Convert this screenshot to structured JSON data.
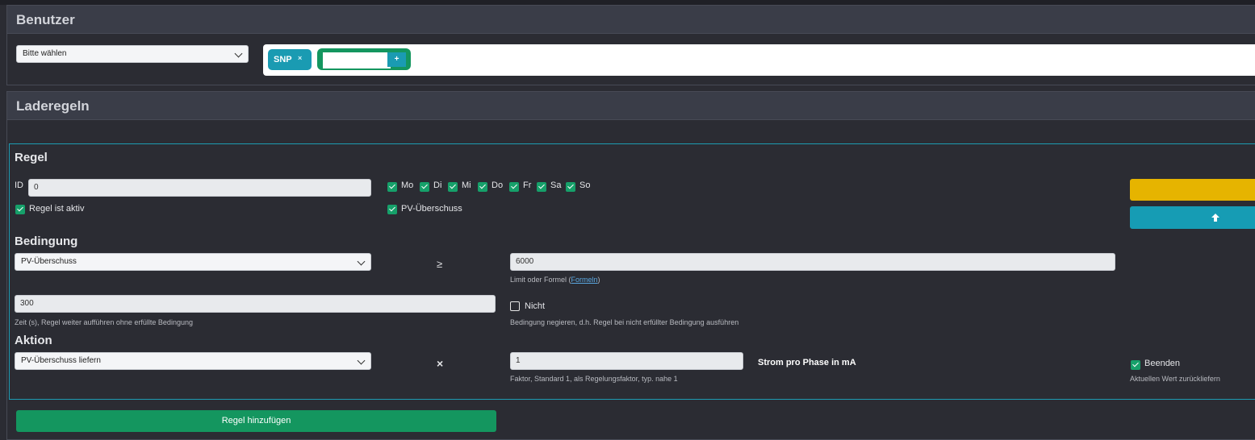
{
  "users_panel": {
    "title": "Benutzer",
    "select_value": "Bitte wählen",
    "tags": [
      {
        "label": "SNP",
        "remove": "×"
      }
    ],
    "add_input_value": "",
    "add_button": "+"
  },
  "rules_panel": {
    "title": "Laderegeln",
    "rule": {
      "heading": "Regel",
      "id_label": "ID",
      "id_value": "0",
      "active_label": "Regel ist aktiv",
      "active_checked": true,
      "days": [
        {
          "label": "Mo",
          "checked": true
        },
        {
          "label": "Di",
          "checked": true
        },
        {
          "label": "Mi",
          "checked": true
        },
        {
          "label": "Do",
          "checked": true
        },
        {
          "label": "Fr",
          "checked": true
        },
        {
          "label": "Sa",
          "checked": true
        },
        {
          "label": "So",
          "checked": true
        }
      ],
      "pv_label": "PV-Überschuss",
      "pv_checked": true
    },
    "condition": {
      "heading": "Bedingung",
      "source_select": "PV-Überschuss",
      "operator": "≥",
      "limit_value": "6000",
      "limit_help_prefix": "Limit oder Formel (",
      "limit_help_link": "Formeln",
      "limit_help_suffix": ")",
      "time_value": "300",
      "time_help": "Zeit (s), Regel weiter aufführen ohne erfüllte Bedingung",
      "negate_label": "Nicht",
      "negate_checked": false,
      "negate_help": "Bedingung negieren, d.h. Regel bei nicht erfüllter Bedingung ausführen"
    },
    "action": {
      "heading": "Aktion",
      "action_select": "PV-Überschuss liefern",
      "operator": "×",
      "factor_value": "1",
      "factor_help": "Faktor, Standard 1, als Regelungsfaktor, typ. nahe 1",
      "unit_label": "Strom pro Phase in mA",
      "end_label": "Beenden",
      "end_checked": true,
      "end_help": "Aktuellen Wert zurückliefern"
    },
    "side_buttons": {
      "move_up_icon": "arrow-up-icon"
    },
    "add_rule_button": "Regel hinzufügen"
  },
  "colors": {
    "accent_teal": "#169cb4",
    "success_green": "#14965f",
    "warning_yellow": "#e6b400"
  }
}
